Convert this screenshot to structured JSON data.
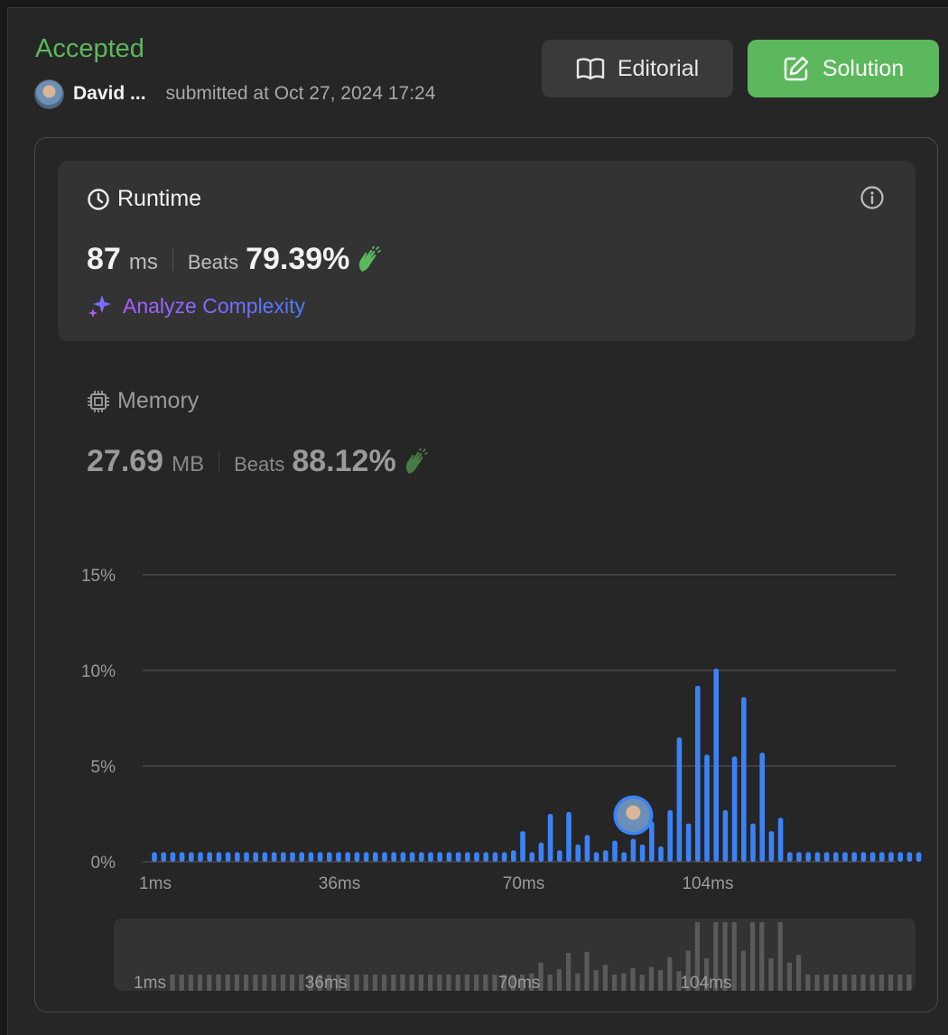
{
  "header": {
    "status": "Accepted",
    "user_name": "David ...",
    "submitted_text": "submitted at Oct 27, 2024 17:24",
    "editorial_label": "Editorial",
    "solution_label": "Solution"
  },
  "runtime": {
    "title": "Runtime",
    "value": "87",
    "unit": "ms",
    "beats_label": "Beats",
    "beats_value": "79.39%",
    "analyze_label": "Analyze Complexity"
  },
  "memory": {
    "title": "Memory",
    "value": "27.69",
    "unit": "MB",
    "beats_label": "Beats",
    "beats_value": "88.12%"
  },
  "colors": {
    "accent_green": "#5cb85c",
    "bar_blue": "#3b82f6",
    "mini_bar": "#5a5a5a"
  },
  "icons": [
    "book-icon",
    "edit-icon",
    "clock-icon",
    "info-icon",
    "clap-icon",
    "sparkle-icon",
    "chip-icon"
  ],
  "chart_data": {
    "type": "bar",
    "ylabel": "",
    "xlabel": "",
    "y_ticks": [
      "15%",
      "10%",
      "5%",
      "0%"
    ],
    "x_ticks": [
      "1ms",
      "36ms",
      "70ms",
      "104ms"
    ],
    "ylim": [
      0,
      15
    ],
    "values": [
      0.5,
      0.5,
      0.5,
      0.5,
      0.5,
      0.5,
      0.5,
      0.5,
      0.5,
      0.5,
      0.5,
      0.5,
      0.5,
      0.5,
      0.5,
      0.5,
      0.5,
      0.5,
      0.5,
      0.5,
      0.5,
      0.5,
      0.5,
      0.5,
      0.5,
      0.5,
      0.5,
      0.5,
      0.5,
      0.5,
      0.5,
      0.5,
      0.5,
      0.5,
      0.5,
      0.5,
      0.5,
      0.5,
      0.5,
      0.6,
      1.6,
      0.5,
      1.0,
      2.5,
      0.6,
      2.6,
      0.9,
      1.4,
      0.5,
      0.6,
      1.1,
      0.5,
      1.2,
      0.9,
      2.1,
      0.8,
      2.7,
      6.5,
      2.0,
      9.2,
      5.6,
      10.1,
      2.7,
      5.5,
      8.6,
      2.0,
      5.7,
      1.6,
      2.3,
      0.5,
      0.5,
      0.5,
      0.5,
      0.5,
      0.5,
      0.5,
      0.5,
      0.5,
      0.5,
      0.5,
      0.5,
      0.5,
      0.5,
      0.5
    ],
    "user_bar_index": 52,
    "mini_x_ticks": [
      "1ms",
      "36ms",
      "70ms",
      "104ms"
    ]
  }
}
